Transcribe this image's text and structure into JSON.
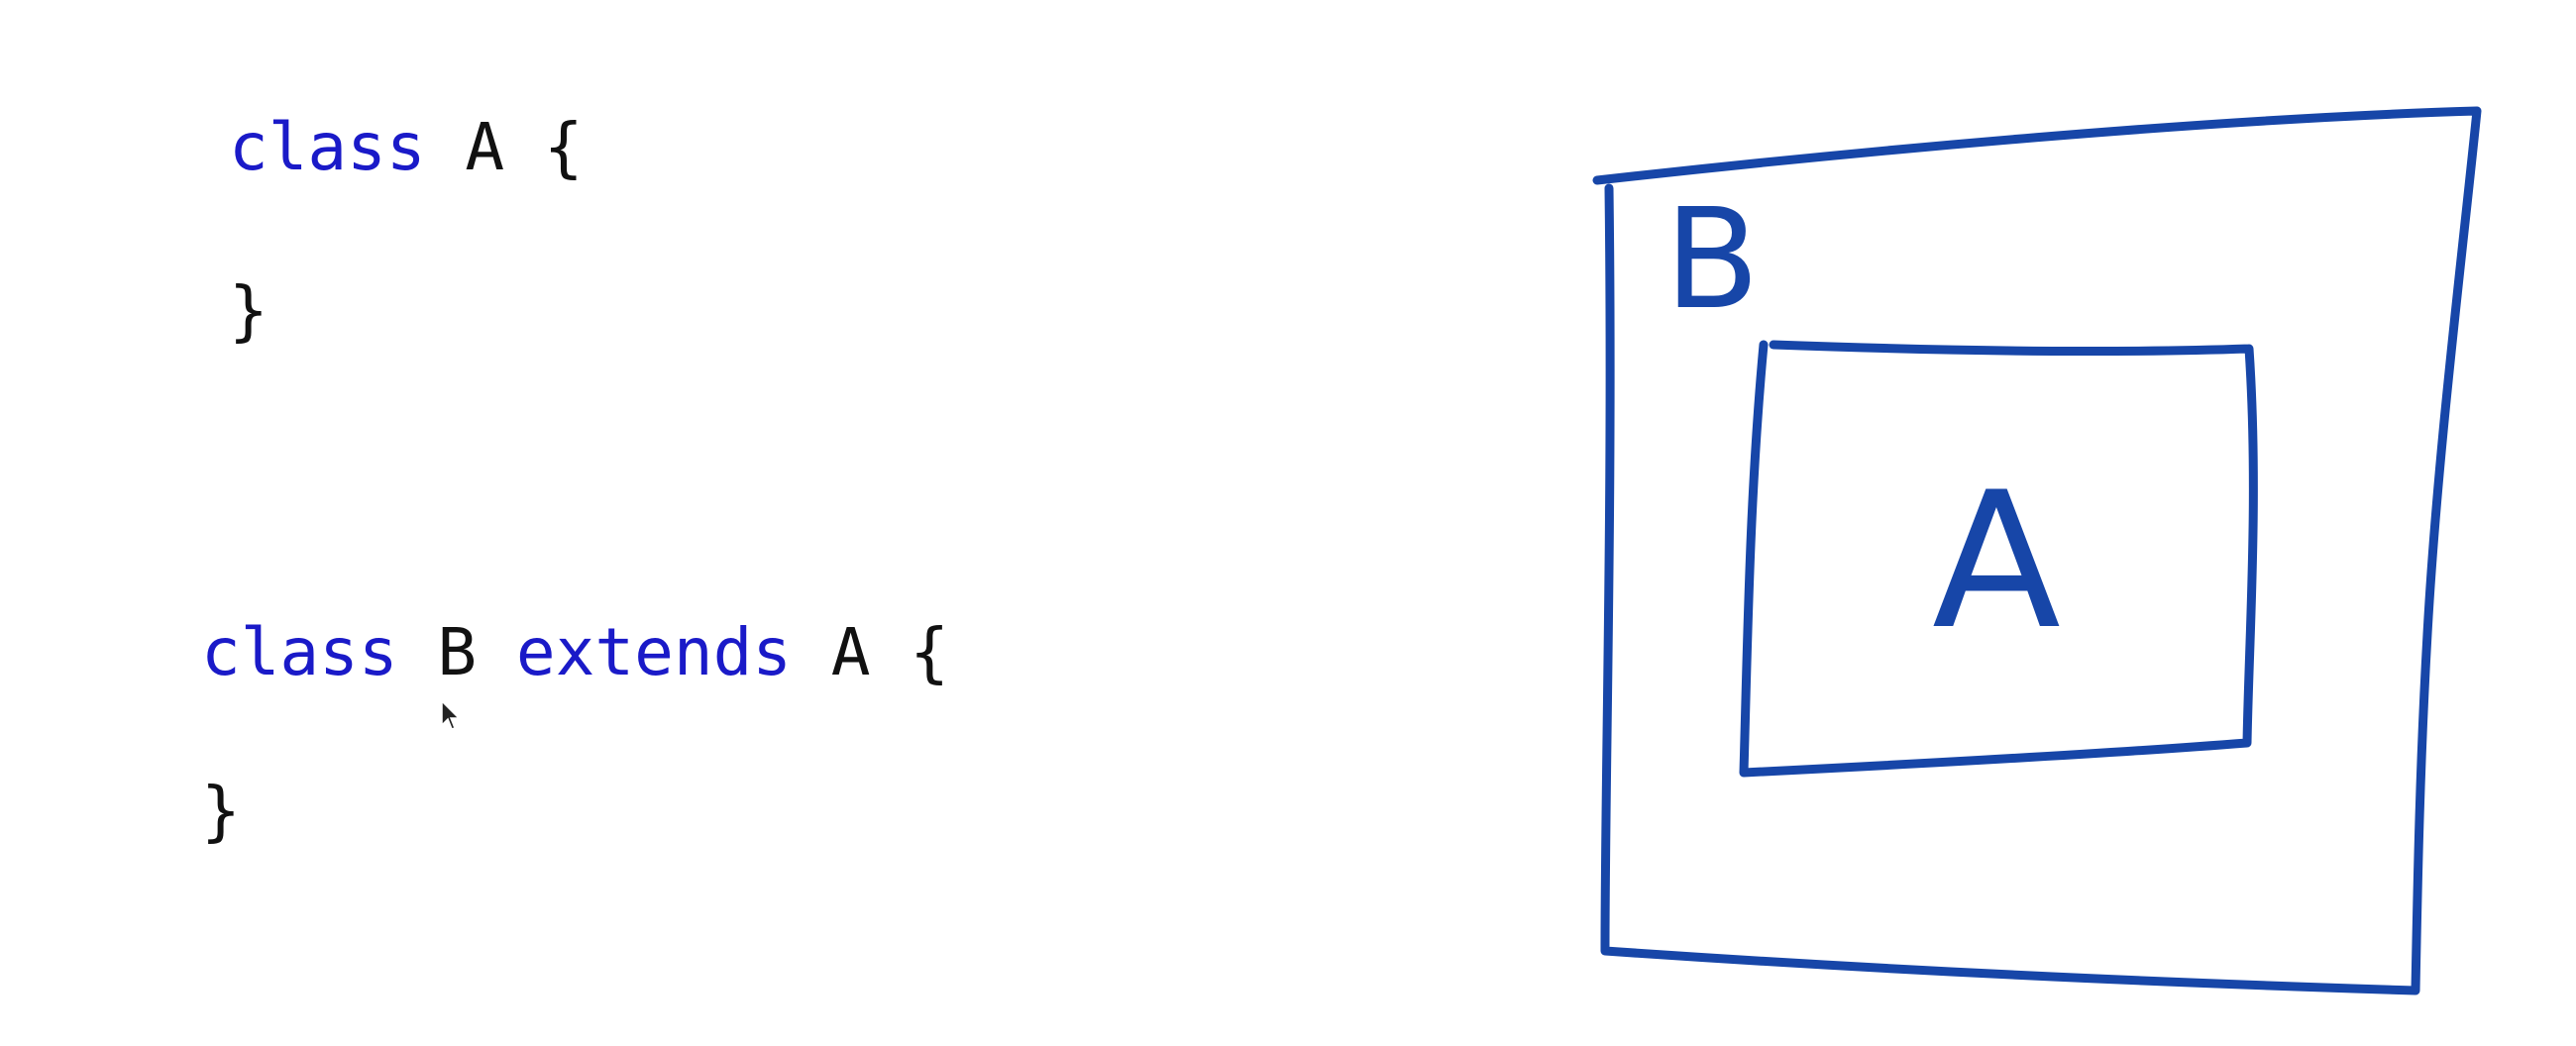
{
  "code": {
    "line1": {
      "kw": "class",
      "name": "A",
      "brace": "{"
    },
    "line2": {
      "brace": "}"
    },
    "line3": {
      "kw": "class",
      "name": "B",
      "kw2": "extends",
      "parent": "A",
      "brace": "{"
    },
    "line4": {
      "brace": "}"
    }
  },
  "diagram": {
    "outer_label": "B",
    "inner_label": "A",
    "stroke_color": "#1746a8"
  },
  "colors": {
    "keyword": "#1a1ac8",
    "text": "#111111",
    "background": "#ffffff"
  }
}
